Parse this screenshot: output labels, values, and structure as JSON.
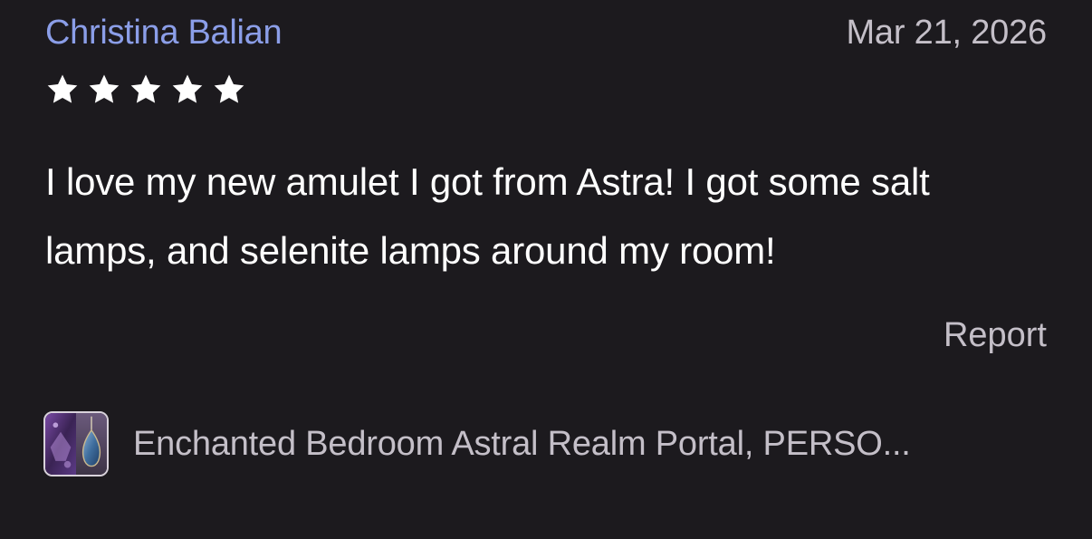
{
  "review": {
    "reviewer_name": "Christina Balian",
    "date": "Mar 21, 2026",
    "rating": 5,
    "rating_max": 5,
    "text": "I love my new amulet I got from Astra! I got some salt lamps, and selenite lamps around my room!",
    "report_label": "Report"
  },
  "product": {
    "title": "Enchanted Bedroom Astral Realm Portal, PERSO..."
  },
  "colors": {
    "background": "#1c1a1e",
    "reviewer_name": "#8b9ee8",
    "muted_text": "#c4bfc8",
    "body_text": "#ffffff",
    "star": "#ffffff"
  },
  "icons": {
    "star": "star-icon",
    "product_thumbnail": "product-thumbnail"
  }
}
